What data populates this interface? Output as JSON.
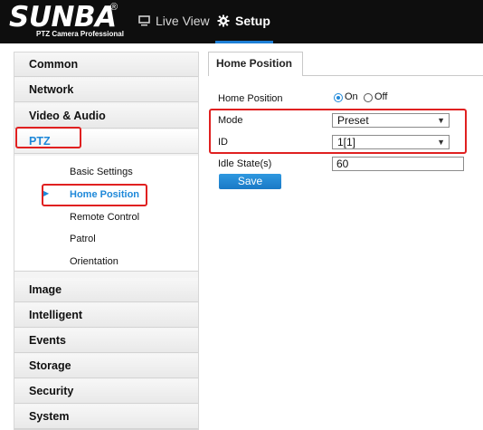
{
  "header": {
    "logo_text": "SUNBA",
    "logo_reg": "®",
    "logo_subtitle": "PTZ Camera Professional",
    "nav": [
      {
        "label": "Live View",
        "icon": "monitor-icon"
      },
      {
        "label": "Setup",
        "icon": "gear-icon"
      }
    ]
  },
  "sidebar": {
    "items": [
      {
        "label": "Common"
      },
      {
        "label": "Network"
      },
      {
        "label": "Video & Audio"
      },
      {
        "label": "PTZ"
      },
      {
        "label": "Image"
      },
      {
        "label": "Intelligent"
      },
      {
        "label": "Events"
      },
      {
        "label": "Storage"
      },
      {
        "label": "Security"
      },
      {
        "label": "System"
      }
    ],
    "ptz_subitems": [
      {
        "label": "Basic Settings"
      },
      {
        "label": "Home Position"
      },
      {
        "label": "Remote Control"
      },
      {
        "label": "Patrol"
      },
      {
        "label": "Orientation"
      }
    ]
  },
  "content": {
    "tab": "Home Position",
    "home_position": {
      "label": "Home Position",
      "on_label": "On",
      "off_label": "Off",
      "selected": "On"
    },
    "mode": {
      "label": "Mode",
      "value": "Preset"
    },
    "id": {
      "label": "ID",
      "value": "1[1]"
    },
    "idle_state": {
      "label": "Idle State(s)",
      "value": "60"
    },
    "save_label": "Save"
  },
  "colors": {
    "accent": "#1e88d9",
    "highlight": "#e02020",
    "header_bg": "#0e0e0e"
  }
}
